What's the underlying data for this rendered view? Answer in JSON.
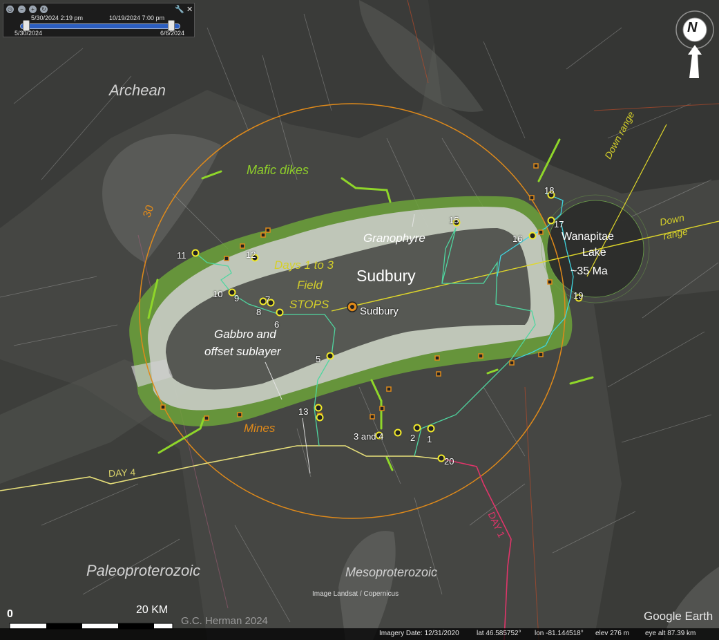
{
  "time_slider": {
    "start_datetime": "5/30/2024   2:19 pm",
    "end_datetime": "10/19/2024   7:00 pm",
    "range_start": "5/30/2024",
    "range_end": "6/6/2024",
    "close_glyph": "✕",
    "settings_icon": "wrench-icon"
  },
  "compass": {
    "north_label": "N",
    "icon": "north-arrow-icon"
  },
  "region_labels": {
    "archean": "Archean",
    "paleoproterozoic": "Paleoproterozoic",
    "mesoproterozoic": "Mesoproterozoic"
  },
  "unit_labels": {
    "granophyre": "Granophyre",
    "gabbro_line1": "Gabbro and",
    "gabbro_line2": "offset sublayer"
  },
  "annotations": {
    "mafic_dikes": "Mafic dikes",
    "mines": "Mines",
    "days_line1": "Days 1 to 3",
    "days_line2": "Field",
    "days_line3": "STOPS",
    "ring_30": "30",
    "down_range_1": "Down range",
    "down_range_2_line1": "Down",
    "down_range_2_line2": "range",
    "lake_line1": "Wanapitae",
    "lake_line2": "Lake",
    "lake_line3": "~35 Ma",
    "day4": "DAY 4",
    "day1": "DAY 1"
  },
  "city": {
    "big_label": "Sudbury",
    "small_label": "Sudbury"
  },
  "stops": {
    "s1": "1",
    "s2": "2",
    "s3and4": "3 and 4",
    "s5": "5",
    "s6": "6",
    "s7": "7",
    "s8": "8",
    "s9": "9",
    "s10": "10",
    "s11": "11",
    "s12": "12",
    "s13": "13",
    "s15": "15",
    "s16": "16",
    "s17": "17",
    "s18": "18",
    "s19": "19",
    "s20": "20"
  },
  "scale": {
    "zero": "0",
    "distance": "20 KM"
  },
  "attribution": {
    "imagery_credit": "Image Landsat / Copernicus",
    "author": "G.C. Herman 2024",
    "brand": "Google Earth"
  },
  "status_bar": {
    "imagery_date": "Imagery Date: 12/31/2020",
    "lat": "lat   46.585752°",
    "lon": "lon  -81.144518°",
    "elev": "elev   276 m",
    "eye_alt": "eye alt  87.39 km"
  },
  "colors": {
    "ring": "#e08a1a",
    "dike": "#8fd62a",
    "granophyre_band": "#d8d8d8",
    "norite_band": "#6ea83a",
    "day4_route": "#e8e07a",
    "day1_route": "#e0356a",
    "stop_route": "#4fd6a0",
    "lake_route": "#3fd6e0",
    "target_line": "#e0d82a",
    "stop_marker": "#f2ea2a"
  }
}
